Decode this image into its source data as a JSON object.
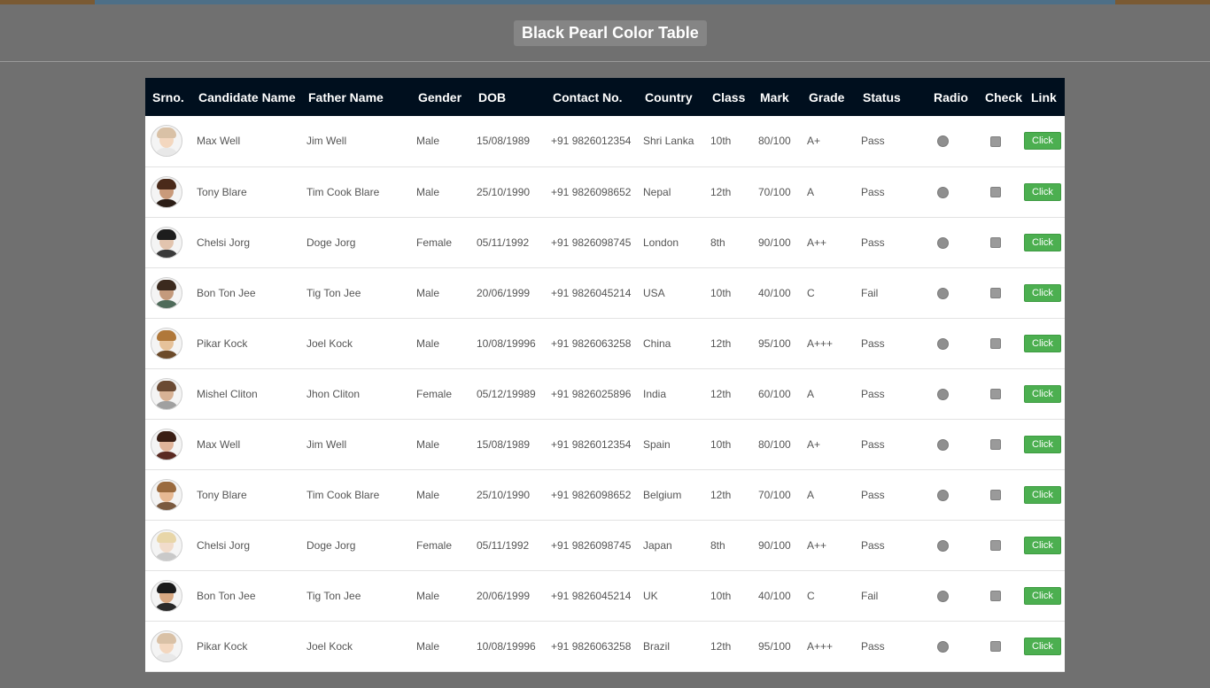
{
  "page": {
    "title": "Black Pearl Color Table"
  },
  "table": {
    "headers": [
      "Srno.",
      "Candidate Name",
      "Father Name",
      "Gender",
      "DOB",
      "Contact No.",
      "Country",
      "Class",
      "Mark",
      "Grade",
      "Status",
      "Radio",
      "Check",
      "Link"
    ],
    "link_label": "Click",
    "rows": [
      {
        "avatar": "avatar-icon",
        "name": "Max Well",
        "father": "Jim Well",
        "gender": "Male",
        "dob": "15/08/1989",
        "contact": "+91 9826012354",
        "country": "Shri Lanka",
        "class": "10th",
        "mark": "80/100",
        "grade": "A+",
        "status": "Pass"
      },
      {
        "avatar": "avatar-icon",
        "name": "Tony Blare",
        "father": "Tim Cook Blare",
        "gender": "Male",
        "dob": "25/10/1990",
        "contact": "+91 9826098652",
        "country": "Nepal",
        "class": "12th",
        "mark": "70/100",
        "grade": "A",
        "status": "Pass"
      },
      {
        "avatar": "avatar-icon",
        "name": "Chelsi Jorg",
        "father": "Doge Jorg",
        "gender": "Female",
        "dob": "05/11/1992",
        "contact": "+91 9826098745",
        "country": "London",
        "class": "8th",
        "mark": "90/100",
        "grade": "A++",
        "status": "Pass"
      },
      {
        "avatar": "avatar-icon",
        "name": "Bon Ton Jee",
        "father": "Tig Ton Jee",
        "gender": "Male",
        "dob": "20/06/1999",
        "contact": "+91 9826045214",
        "country": "USA",
        "class": "10th",
        "mark": "40/100",
        "grade": "C",
        "status": "Fail"
      },
      {
        "avatar": "avatar-icon",
        "name": "Pikar Kock",
        "father": "Joel Kock",
        "gender": "Male",
        "dob": "10/08/19996",
        "contact": "+91 9826063258",
        "country": "China",
        "class": "12th",
        "mark": "95/100",
        "grade": "A+++",
        "status": "Pass"
      },
      {
        "avatar": "avatar-icon",
        "name": "Mishel Cliton",
        "father": "Jhon Cliton",
        "gender": "Female",
        "dob": "05/12/19989",
        "contact": "+91 9826025896",
        "country": "India",
        "class": "12th",
        "mark": "60/100",
        "grade": "A",
        "status": "Pass"
      },
      {
        "avatar": "avatar-icon",
        "name": "Max Well",
        "father": "Jim Well",
        "gender": "Male",
        "dob": "15/08/1989",
        "contact": "+91 9826012354",
        "country": "Spain",
        "class": "10th",
        "mark": "80/100",
        "grade": "A+",
        "status": "Pass"
      },
      {
        "avatar": "avatar-icon",
        "name": "Tony Blare",
        "father": "Tim Cook Blare",
        "gender": "Male",
        "dob": "25/10/1990",
        "contact": "+91 9826098652",
        "country": "Belgium",
        "class": "12th",
        "mark": "70/100",
        "grade": "A",
        "status": "Pass"
      },
      {
        "avatar": "avatar-icon",
        "name": "Chelsi Jorg",
        "father": "Doge Jorg",
        "gender": "Female",
        "dob": "05/11/1992",
        "contact": "+91 9826098745",
        "country": "Japan",
        "class": "8th",
        "mark": "90/100",
        "grade": "A++",
        "status": "Pass"
      },
      {
        "avatar": "avatar-icon",
        "name": "Bon Ton Jee",
        "father": "Tig Ton Jee",
        "gender": "Male",
        "dob": "20/06/1999",
        "contact": "+91 9826045214",
        "country": "UK",
        "class": "10th",
        "mark": "40/100",
        "grade": "C",
        "status": "Fail"
      },
      {
        "avatar": "avatar-icon",
        "name": "Pikar Kock",
        "father": "Joel Kock",
        "gender": "Male",
        "dob": "10/08/19996",
        "contact": "+91 9826063258",
        "country": "Brazil",
        "class": "12th",
        "mark": "95/100",
        "grade": "A+++",
        "status": "Pass"
      }
    ]
  },
  "colors": {
    "background": "#707070",
    "header_bg": "#000f1e",
    "button_green": "#4caf50",
    "title_badge": "#858585",
    "top_strip_blue": "#4d6f87",
    "top_strip_wood": "#7a5a33"
  }
}
